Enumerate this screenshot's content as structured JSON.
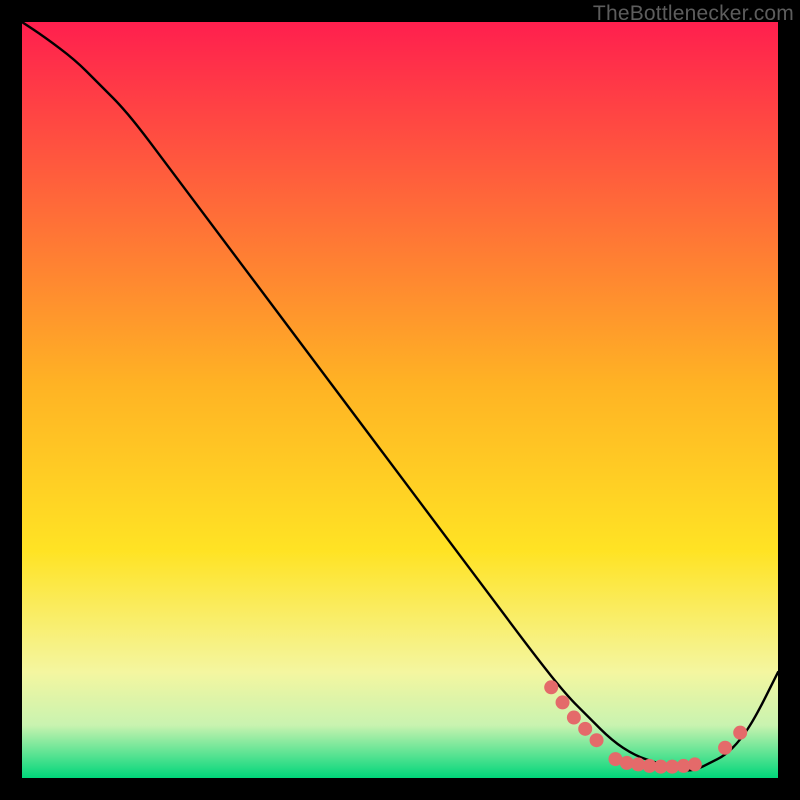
{
  "watermark": "TheBottlenecker.com",
  "chart_data": {
    "type": "line",
    "title": "",
    "xlabel": "",
    "ylabel": "",
    "xlim": [
      0,
      100
    ],
    "ylim": [
      0,
      100
    ],
    "background_gradient": {
      "top_color": "#ff1f4e",
      "mid_color": "#ffe324",
      "bottom_color": "#00d67a"
    },
    "series": [
      {
        "name": "curve",
        "color": "#000000",
        "x": [
          0,
          3,
          7,
          10,
          14,
          20,
          26,
          32,
          38,
          44,
          50,
          56,
          62,
          68,
          72,
          75,
          78,
          81,
          84,
          87,
          89,
          91,
          93,
          95,
          97,
          100
        ],
        "y": [
          100,
          98,
          95,
          92,
          88,
          80,
          72,
          64,
          56,
          48,
          40,
          32,
          24,
          16,
          11,
          8,
          5,
          3,
          2,
          1,
          1,
          2,
          3,
          5,
          8,
          14
        ]
      }
    ],
    "markers": {
      "color": "#e46a6a",
      "radius_px": 7,
      "points": [
        {
          "x": 70.0,
          "y": 12.0
        },
        {
          "x": 71.5,
          "y": 10.0
        },
        {
          "x": 73.0,
          "y": 8.0
        },
        {
          "x": 74.5,
          "y": 6.5
        },
        {
          "x": 76.0,
          "y": 5.0
        },
        {
          "x": 78.5,
          "y": 2.5
        },
        {
          "x": 80.0,
          "y": 2.0
        },
        {
          "x": 81.5,
          "y": 1.8
        },
        {
          "x": 83.0,
          "y": 1.6
        },
        {
          "x": 84.5,
          "y": 1.5
        },
        {
          "x": 86.0,
          "y": 1.5
        },
        {
          "x": 87.5,
          "y": 1.6
        },
        {
          "x": 89.0,
          "y": 1.8
        },
        {
          "x": 93.0,
          "y": 4.0
        },
        {
          "x": 95.0,
          "y": 6.0
        }
      ]
    }
  }
}
